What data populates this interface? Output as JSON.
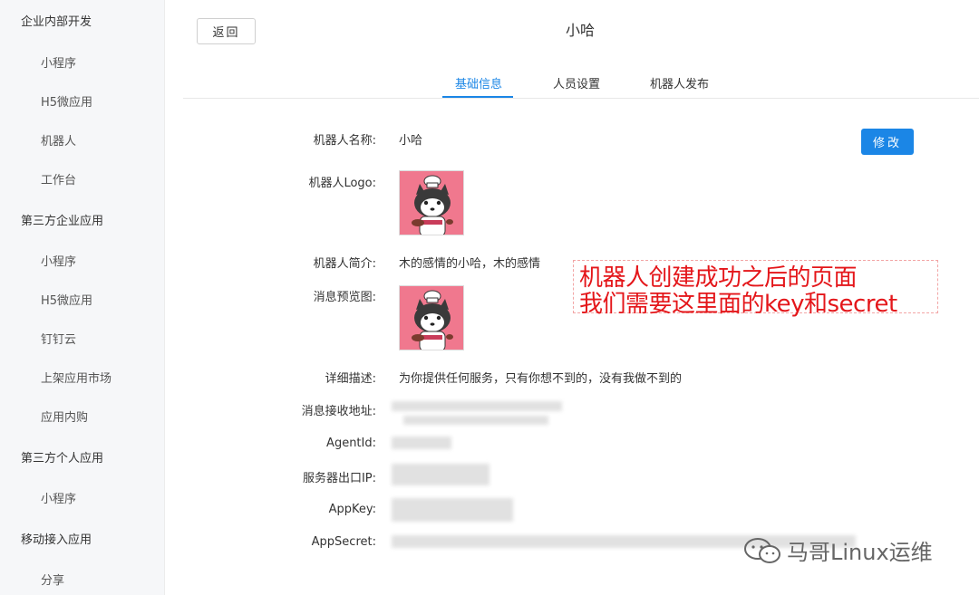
{
  "sidebar": {
    "groups": [
      {
        "label": "企业内部开发",
        "items": [
          "小程序",
          "H5微应用",
          "机器人",
          "工作台"
        ]
      },
      {
        "label": "第三方企业应用",
        "items": [
          "小程序",
          "H5微应用",
          "钉钉云",
          "上架应用市场",
          "应用内购"
        ]
      },
      {
        "label": "第三方个人应用",
        "items": [
          "小程序"
        ]
      },
      {
        "label": "移动接入应用",
        "items": [
          "分享"
        ]
      }
    ]
  },
  "header": {
    "back_label": "返回",
    "title": "小哈"
  },
  "tabs": [
    {
      "label": "基础信息",
      "active": true
    },
    {
      "label": "人员设置",
      "active": false
    },
    {
      "label": "机器人发布",
      "active": false
    }
  ],
  "form": {
    "edit_label": "修改",
    "name_label": "机器人名称:",
    "name_value": "小哈",
    "logo_label": "机器人Logo:",
    "intro_label": "机器人简介:",
    "intro_value": "木的感情的小哈，木的感情",
    "preview_label": "消息预览图:",
    "detail_label": "详细描述:",
    "detail_value": "为你提供任何服务，只有你想不到的，没有我做不到的",
    "endpoint_label": "消息接收地址:",
    "agentid_label": "AgentId:",
    "serverip_label": "服务器出口IP:",
    "appkey_label": "AppKey:",
    "appsecret_label": "AppSecret:"
  },
  "annotation": {
    "line1": "机器人创建成功之后的页面",
    "line2": "我们需要这里面的key和secret"
  },
  "watermark": {
    "text": "马哥Linux运维"
  },
  "colors": {
    "accent": "#1b86e6",
    "annotation": "#e4161a",
    "logo_bg": "#f0788e"
  }
}
